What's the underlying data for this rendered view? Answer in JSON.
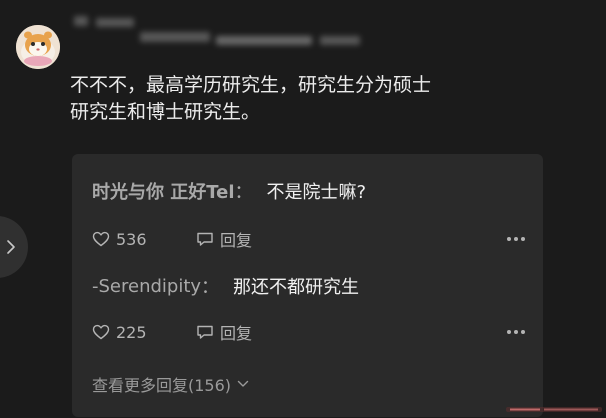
{
  "comment": {
    "text": "不不不，最高学历研究生，研究生分为硕士\n研究生和博士研究生。"
  },
  "replies": [
    {
      "author": "时光与你 正好Tel",
      "separator": "：",
      "content": "不是院士嘛?",
      "likes": "536",
      "reply_label": "回复"
    },
    {
      "author": "-Serendipity",
      "separator": "：",
      "content": "那还不都研究生",
      "likes": "225",
      "reply_label": "回复"
    }
  ],
  "view_more": "查看更多回复(156)",
  "icons": {
    "like": "heart-outline-icon",
    "reply": "speech-bubble-icon",
    "more": "ellipsis-icon",
    "expand": "chevron-down-icon",
    "nav": "chevron-right-icon"
  },
  "colors": {
    "background": "#1b1b1b",
    "reply_panel": "#2a2a2a",
    "text": "#ececec",
    "muted": "#a9a9a9"
  }
}
